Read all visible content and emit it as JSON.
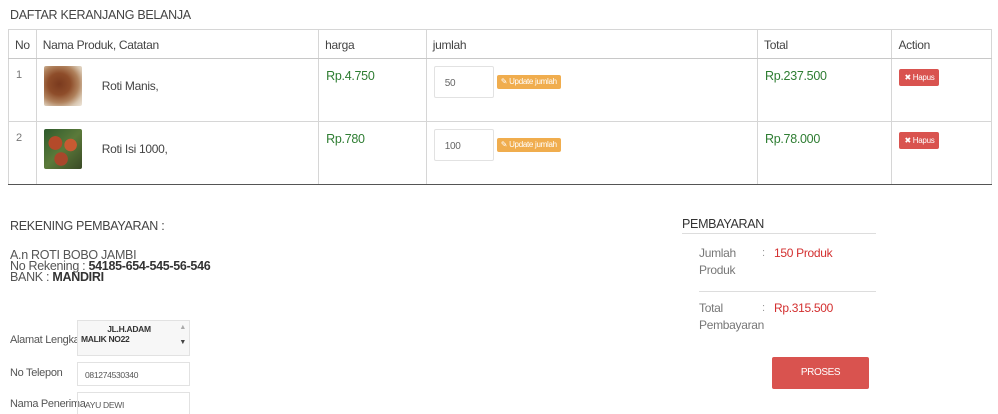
{
  "cart": {
    "title": "DAFTAR KERANJANG BELANJA",
    "headers": [
      "No",
      "Nama Produk, Catatan",
      "harga",
      "jumlah",
      "Total",
      "Action"
    ],
    "items": [
      {
        "no": "1",
        "name": "Roti Manis,",
        "price": "Rp.4.750",
        "qty": "50",
        "update_label": "Update jumlah",
        "total": "Rp.237.500",
        "delete_label": "Hapus"
      },
      {
        "no": "2",
        "name": "Roti Isi 1000,",
        "price": "Rp.780",
        "qty": "100",
        "update_label": "Update jumlah",
        "total": "Rp.78.000",
        "delete_label": "Hapus"
      }
    ]
  },
  "rekening": {
    "title": "REKENING PEMBAYARAN :",
    "account_name": "A.n ROTI BOBO JAMBI",
    "account_number_label": "No Rekening :",
    "account_number": "54185-654-545-56-546",
    "bank_label": "BANK :",
    "bank": "MANDIRI"
  },
  "shipping": {
    "address_label": "Alamat Lengkap",
    "address_line1": "JL.H.ADAM",
    "address_line2": "MALIK NO22",
    "phone_label": "No Telepon",
    "phone": "081274530340",
    "recipient_label": "Nama Penerima",
    "recipient": "AYU DEWI"
  },
  "payment": {
    "title": "PEMBAYARAN",
    "qty_label_1": "Jumlah",
    "qty_label_2": "Produk",
    "qty_value": "150 Produk",
    "total_label_1": "Total",
    "total_label_2": "Pembayaran",
    "total_value": "Rp.315.500",
    "submit_label": "PROSES PEMESANAN"
  },
  "colors": {
    "price": "#2e7d32",
    "delete": "#d9534f",
    "update": "#f0ad4e",
    "accent_red": "#d32f2f"
  }
}
